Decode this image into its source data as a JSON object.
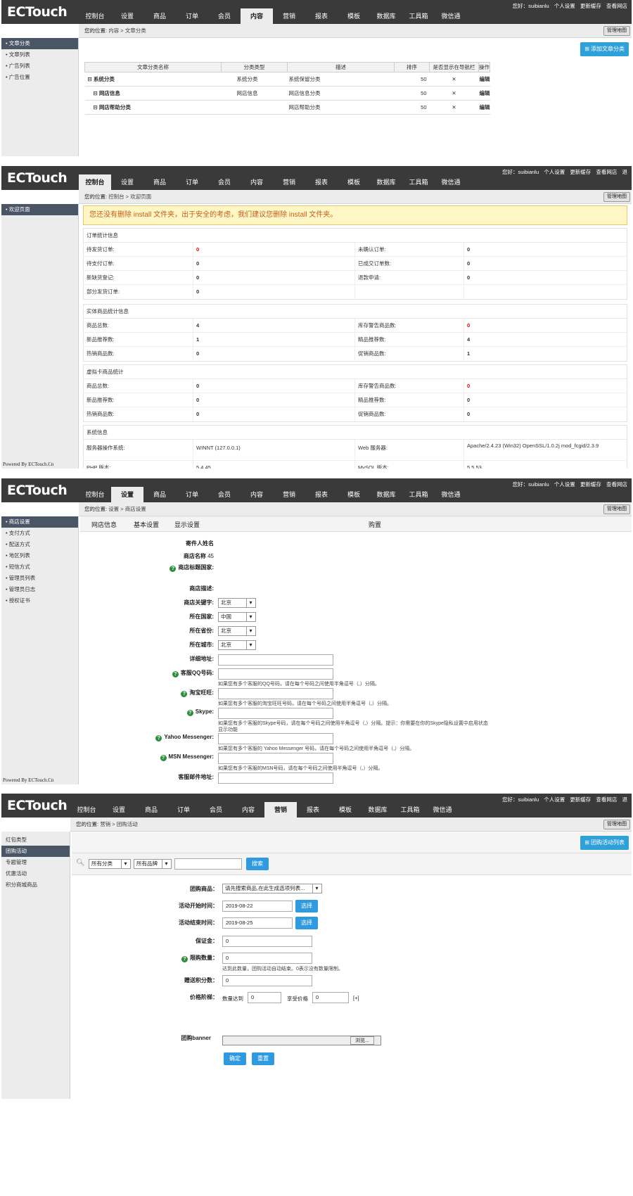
{
  "brand": {
    "logo_text": "ECTouch",
    "powered_by": "Powered By ECTouch.Cn"
  },
  "header": {
    "greeting": "您好：suibianlu",
    "links": [
      "个人设置",
      "更新缓存",
      "查看网店",
      "退"
    ],
    "nav": [
      "控制台",
      "设置",
      "商品",
      "订单",
      "会员",
      "内容",
      "营销",
      "报表",
      "模板",
      "数据库",
      "工具箱",
      "微信通"
    ],
    "manage_button": "管理地图"
  },
  "panel1": {
    "breadcrumb_prefix": "您的位置:",
    "breadcrumb": "内容 > 文章分类",
    "sidebar": [
      "文章分类",
      "文章列表",
      "广告列表",
      "广告位置"
    ],
    "add_button": "添加文章分类",
    "columns": [
      "文章分类名称",
      "分类类型",
      "描述",
      "排序",
      "是否显示在导航栏",
      "操作"
    ],
    "rows": [
      {
        "name": "⊟ 系统分类",
        "type": "系统分类",
        "desc": "系统保留分类",
        "sort": "50",
        "action": "编辑"
      },
      {
        "name": "⊟ 网店信息",
        "type": "网店信息",
        "desc": "网店信息分类",
        "sort": "50",
        "action": "编辑"
      },
      {
        "name": "⊟ 网店帮助分类",
        "type": "",
        "desc": "网店帮助分类",
        "sort": "50",
        "action": "编辑"
      }
    ]
  },
  "panel2": {
    "breadcrumb_prefix": "您的位置:",
    "breadcrumb": "控制台 > 欢迎页面",
    "sidebar": [
      "欢迎页面"
    ],
    "warning": "您还没有删除 install 文件夹，出于安全的考虑，我们建议您删除 install 文件夹。",
    "sections": [
      {
        "title": "订单统计信息",
        "rows": [
          [
            "待发货订单:",
            "0",
            "未确认订单:",
            "0"
          ],
          [
            "待支付订单:",
            "0",
            "已成交订单数:",
            "0"
          ],
          [
            "新缺货登记:",
            "0",
            "退款申请:",
            "0"
          ],
          [
            "部分发货订单:",
            "0",
            "",
            ""
          ]
        ]
      },
      {
        "title": "实体商品统计信息",
        "rows": [
          [
            "商品总数:",
            "4",
            "库存警告商品数:",
            "0"
          ],
          [
            "新品推荐数:",
            "1",
            "精品推荐数:",
            "4"
          ],
          [
            "热销商品数:",
            "0",
            "促销商品数:",
            "1"
          ]
        ]
      },
      {
        "title": "虚拟卡商品统计",
        "rows": [
          [
            "商品总数:",
            "0",
            "库存警告商品数:",
            "0"
          ],
          [
            "新品推荐数:",
            "0",
            "精品推荐数:",
            "0"
          ],
          [
            "热销商品数:",
            "0",
            "促销商品数:",
            "0"
          ]
        ]
      },
      {
        "title": "系统信息",
        "rows": [
          [
            "服务器操作系统:",
            "WINNT (127.0.0.1)",
            "Web 服务器:",
            "Apache/2.4.23 (Win32) OpenSSL/1.0.2j mod_fcgid/2.3.9"
          ],
          [
            "PHP 版本:",
            "5.4.45",
            "MySQL 版本:",
            "5.5.53"
          ]
        ]
      }
    ]
  },
  "panel3": {
    "breadcrumb_prefix": "您的位置:",
    "breadcrumb": "设置 > 商店设置",
    "sidebar": [
      "商店设置",
      "支付方式",
      "配送方式",
      "地区列表",
      "短信方式",
      "管理员列表",
      "管理员日志",
      "授权证书"
    ],
    "tabs": [
      "网店信息",
      "基本设置",
      "显示设置",
      "购置"
    ],
    "fields": {
      "sender": "寄件人姓名",
      "shop_name": "商店名称",
      "shop_name_value": "45",
      "shop_title": "商店标题国家:",
      "shop_desc": "商店描述:",
      "keywords": "商店关键字:",
      "keywords_value": "北京",
      "country": "所在国家:",
      "country_value": "中国",
      "province": "所在省份:",
      "province_value": "北京",
      "city": "所在城市:",
      "city_value": "北京",
      "address": "详细地址:",
      "qq": "客服QQ号码:",
      "qq_hint": "如果您有多个客服的QQ号码，请在每个号码之间使用半角逗号（,）分隔。",
      "wangwang": "淘宝旺旺:",
      "wangwang_hint": "如果您有多个客服的淘宝旺旺号码，请在每个号码之间使用半角逗号（,）分隔。",
      "skype": "Skype:",
      "skype_hint": "如果您有多个客服的Skype号码，请在每个号码之间使用半角逗号（,）分隔。提示：你需要在你的Skype隐私设置中启用状态",
      "skype_hint2": "显示功能",
      "yahoo": "Yahoo Messenger:",
      "yahoo_hint": "如果您有多个客服的 Yahoo Messenger 号码，请在每个号码之间使用半角逗号（,）分隔。",
      "msn": "MSN Messenger:",
      "msn_hint": "如果您有多个客服的MSN号码，请在每个号码之间使用半角逗号（,）分隔。",
      "email": "客服邮件地址:"
    }
  },
  "panel4": {
    "breadcrumb_prefix": "您的位置:",
    "breadcrumb": "营销 > 团购活动",
    "sidebar": [
      "红包类型",
      "团购活动",
      "专题管理",
      "优惠活动",
      "积分商城商品"
    ],
    "list_button": "团购活动列表",
    "filter": {
      "category": "所有分类",
      "brand": "所有品牌",
      "search": "搜索"
    },
    "form": {
      "goods_label": "团购商品：",
      "goods_value": "请先搜索商品,在此生成选项列表...",
      "start_label": "活动开始时间：",
      "start_value": "2019-08-22",
      "end_label": "活动结束时间：",
      "end_value": "2019-08-25",
      "pick": "选择",
      "deposit_label": "保证金：",
      "deposit_value": "0",
      "limit_label": "限购数量：",
      "limit_value": "0",
      "limit_hint": "达到此数量，团购活动自动结束。0表示没有数量限制。",
      "points_label": "赠送积分数：",
      "points_value": "0",
      "tier_label": "价格阶梯：",
      "tier_qty": "数量达到",
      "tier_qty_value": "0",
      "tier_price": "享受价格",
      "tier_price_value": "0",
      "tier_add": "[+]",
      "banner_label": "团购banner",
      "browse": "浏览...",
      "submit": "确定",
      "reset": "重置"
    }
  }
}
